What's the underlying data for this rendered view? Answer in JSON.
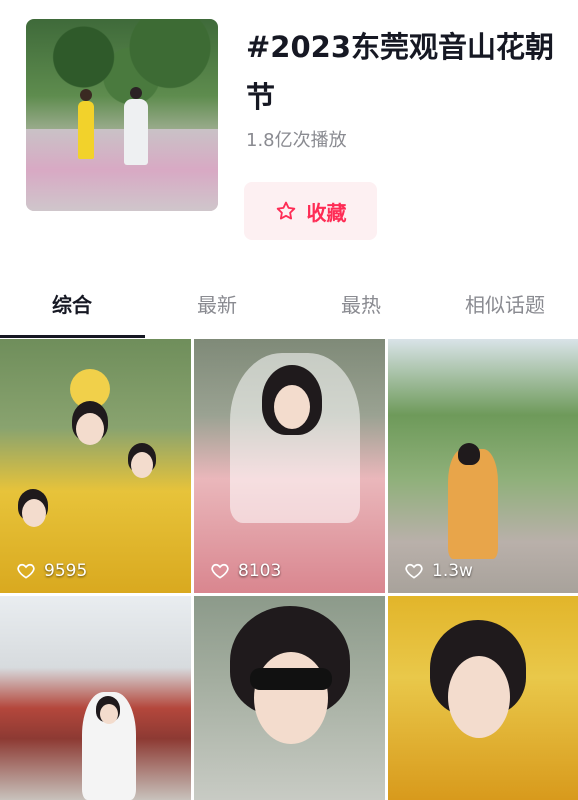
{
  "topic": {
    "title": "#2023东莞观音山花朝节",
    "plays": "1.8亿次播放",
    "favorite_label": "收藏",
    "favorite_icon": "star-outline-icon",
    "accent_color": "#fe2c55"
  },
  "tabs": [
    {
      "label": "综合",
      "active": true
    },
    {
      "label": "最新",
      "active": false
    },
    {
      "label": "最热",
      "active": false
    },
    {
      "label": "相似话题",
      "active": false
    }
  ],
  "videos": [
    {
      "likes": "9595",
      "like_icon": "heart-outline-icon"
    },
    {
      "likes": "8103",
      "like_icon": "heart-outline-icon"
    },
    {
      "likes": "1.3w",
      "like_icon": "heart-outline-icon"
    },
    {
      "likes": "",
      "like_icon": ""
    },
    {
      "likes": "",
      "like_icon": ""
    },
    {
      "likes": "",
      "like_icon": ""
    }
  ]
}
